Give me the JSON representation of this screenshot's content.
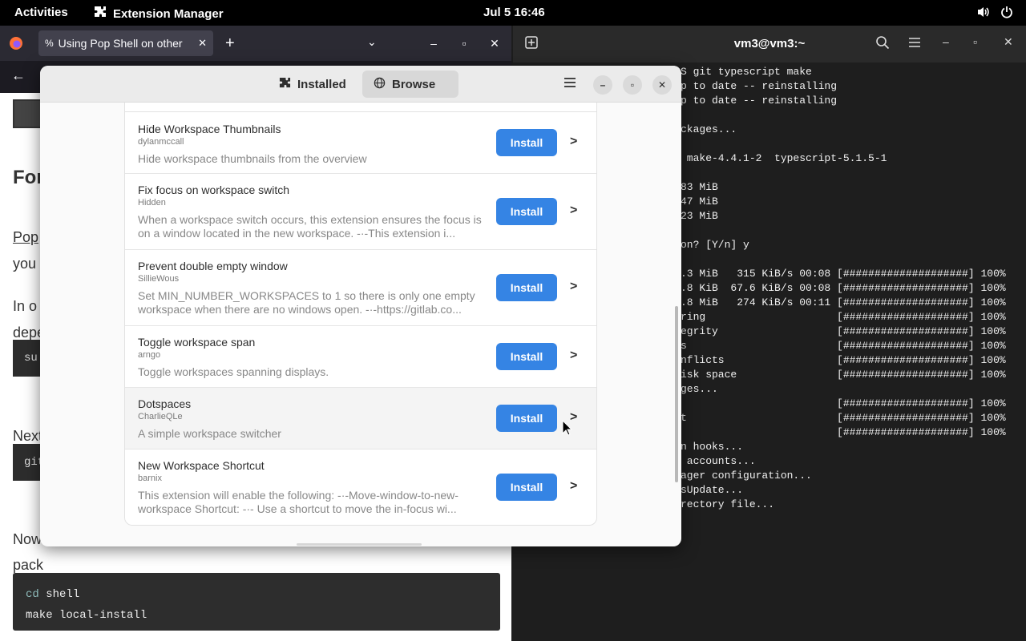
{
  "topbar": {
    "activities": "Activities",
    "app_name": "Extension Manager",
    "clock": "Jul 5  16:46"
  },
  "browser": {
    "tab_title": "Using Pop Shell on other",
    "page": {
      "heading": "For",
      "para1_line1": "Pop",
      "para1_line2": "you",
      "para2_line1": "In o",
      "para2_line2": "depe",
      "code1": "su",
      "para3": "Next",
      "code2": "git",
      "para4_line1": "Now",
      "para4_line2": "pack",
      "code_block": {
        "line1_kw": "cd",
        "line1_rest": " shell",
        "line2": "make local-install"
      }
    }
  },
  "terminal": {
    "title": "vm3@vm3:~",
    "lines": [
      "S git typescript make",
      "p to date -- reinstalling",
      "p to date -- reinstalling",
      "",
      "ckages...",
      "",
      " make-4.4.1-2  typescript-5.1.5-1",
      "",
      "83 MiB",
      "47 MiB",
      "23 MiB",
      "",
      "on? [Y/n] y",
      "",
      ".3 MiB   315 KiB/s 00:08 [####################] 100%",
      ".8 KiB  67.6 KiB/s 00:08 [####################] 100%",
      ".8 MiB   274 KiB/s 00:11 [####################] 100%",
      "ring                     [####################] 100%",
      "egrity                   [####################] 100%",
      "s                        [####################] 100%",
      "nflicts                  [####################] 100%",
      "isk space                [####################] 100%",
      "ges...",
      "                         [####################] 100%",
      "t                        [####################] 100%",
      "                         [####################] 100%",
      "n hooks...",
      " accounts...",
      "ager configuration...",
      "sUpdate...",
      "rectory file..."
    ]
  },
  "extmgr": {
    "tabs": {
      "installed": "Installed",
      "browse": "Browse"
    },
    "extensions": [
      {
        "name": "Hide Workspace Thumbnails",
        "author": "dylanmccall",
        "desc": "Hide workspace thumbnails from the overview",
        "button": "Install"
      },
      {
        "name": "Fix focus on workspace switch",
        "author": "Hidden",
        "desc": "When a workspace switch occurs, this extension ensures the focus is on a window located in the new workspace. -·-This extension i...",
        "button": "Install"
      },
      {
        "name": "Prevent double empty window",
        "author": "SillieWous",
        "desc": "Set MIN_NUMBER_WORKSPACES to 1 so there is only one empty workspace when there are no windows open. -·-https://gitlab.co...",
        "button": "Install"
      },
      {
        "name": "Toggle workspace span",
        "author": "arngo",
        "desc": "Toggle workspaces spanning displays.",
        "button": "Install"
      },
      {
        "name": "Dotspaces",
        "author": "CharlieQLe",
        "desc": "A simple workspace switcher",
        "button": "Install"
      },
      {
        "name": "New Workspace Shortcut",
        "author": "barnix",
        "desc": "This extension will enable the following: -·-Move-window-to-new-workspace Shortcut: -·-      Use a shortcut to move the in-focus wi...",
        "button": "Install"
      }
    ]
  }
}
